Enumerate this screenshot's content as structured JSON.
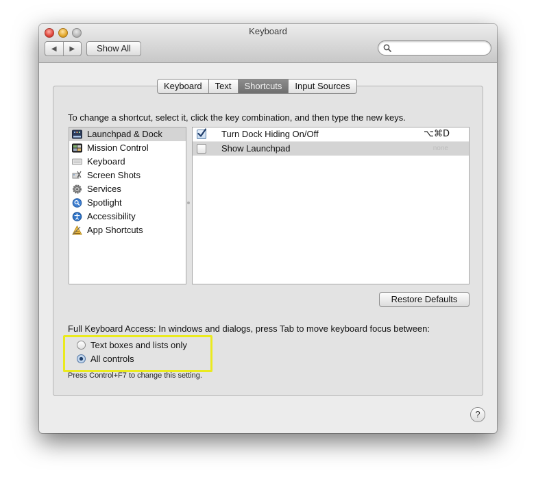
{
  "window": {
    "title": "Keyboard"
  },
  "toolbar": {
    "back_glyph": "◀",
    "forward_glyph": "▶",
    "show_all_label": "Show All"
  },
  "search": {
    "value": "",
    "placeholder": ""
  },
  "tabs": [
    {
      "label": "Keyboard",
      "selected": false
    },
    {
      "label": "Text",
      "selected": false
    },
    {
      "label": "Shortcuts",
      "selected": true
    },
    {
      "label": "Input Sources",
      "selected": false
    }
  ],
  "instructions": "To change a shortcut, select it, click the key combination, and then type the new keys.",
  "categories": [
    {
      "label": "Launchpad & Dock",
      "icon": "launchpad-dock-icon",
      "selected": true
    },
    {
      "label": "Mission Control",
      "icon": "mission-control-icon",
      "selected": false
    },
    {
      "label": "Keyboard",
      "icon": "keyboard-icon",
      "selected": false
    },
    {
      "label": "Screen Shots",
      "icon": "screenshot-icon",
      "selected": false
    },
    {
      "label": "Services",
      "icon": "gear-icon",
      "selected": false
    },
    {
      "label": "Spotlight",
      "icon": "spotlight-icon",
      "selected": false
    },
    {
      "label": "Accessibility",
      "icon": "accessibility-icon",
      "selected": false
    },
    {
      "label": "App Shortcuts",
      "icon": "app-shortcuts-icon",
      "selected": false
    }
  ],
  "shortcuts": [
    {
      "label": "Turn Dock Hiding On/Off",
      "checked": true,
      "keys": "⌥⌘D"
    },
    {
      "label": "Show Launchpad",
      "checked": false,
      "keys": "none"
    }
  ],
  "restore_defaults_label": "Restore Defaults",
  "full_keyboard_access": {
    "label": "Full Keyboard Access: In windows and dialogs, press Tab to move keyboard focus between:",
    "options": [
      {
        "label": "Text boxes and lists only",
        "selected": false
      },
      {
        "label": "All controls",
        "selected": true
      }
    ],
    "hint": "Press Control+F7 to change this setting."
  },
  "help_glyph": "?",
  "colors": {
    "highlight": "#eaea1e",
    "selected_row": "#d4d4d4",
    "selected_tab": "#7a7a7a"
  }
}
